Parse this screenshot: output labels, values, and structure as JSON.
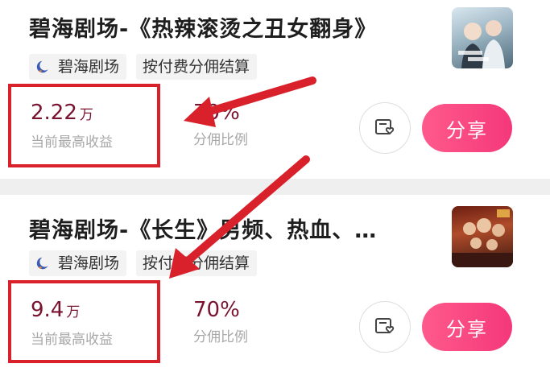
{
  "cards": [
    {
      "title": "碧海剧场-《热辣滚烫之丑女翻身》",
      "source_tag": "碧海剧场",
      "settlement_tag": "按付费分佣结算",
      "income_value": "2.22",
      "income_unit": "万",
      "income_label": "当前最高收益",
      "ratio_value": "70%",
      "ratio_label": "分佣比例",
      "share_label": "分享",
      "thumbnail_icon": "drama-poster-thumbnail"
    },
    {
      "title": "碧海剧场-《长生》男频、热血、…",
      "source_tag": "碧海剧场",
      "settlement_tag": "按付费分佣结算",
      "income_value": "9.4",
      "income_unit": "万",
      "income_label": "当前最高收益",
      "ratio_value": "70%",
      "ratio_label": "分佣比例",
      "share_label": "分享",
      "thumbnail_icon": "drama-poster-thumbnail"
    }
  ],
  "colors": {
    "income_text": "#7a1330",
    "label_text": "#a8a8a8",
    "share_gradient_start": "#ff5a8c",
    "share_gradient_end": "#f4387a",
    "annotation_red": "#d8212a",
    "logo_blue": "#3b5bb5"
  },
  "icons": {
    "logo": "crescent-moon-logo-icon",
    "favorite": "bookmark-heart-icon"
  }
}
